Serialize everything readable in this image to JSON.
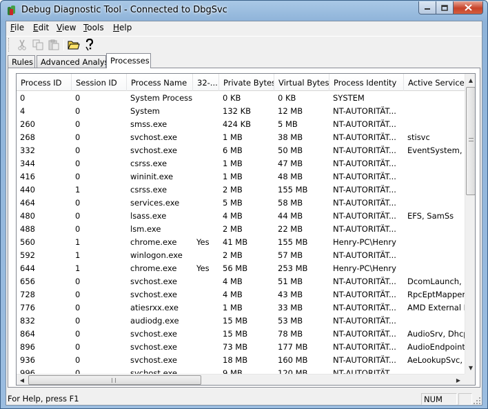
{
  "window": {
    "title": "Debug Diagnostic Tool - Connected to DbgSvc"
  },
  "menu": [
    {
      "label": "File",
      "u": "F",
      "rest": "ile"
    },
    {
      "label": "Edit",
      "u": "E",
      "rest": "dit"
    },
    {
      "label": "View",
      "u": "V",
      "rest": "iew"
    },
    {
      "label": "Tools",
      "u": "T",
      "rest": "ools"
    },
    {
      "label": "Help",
      "u": "H",
      "rest": "elp"
    }
  ],
  "toolbar": {
    "icons": [
      "cut-icon",
      "copy-icon",
      "paste-icon",
      "open-folder-icon",
      "help-icon"
    ]
  },
  "tabs": [
    "Rules",
    "Advanced Analysis",
    "Processes"
  ],
  "active_tab": "Processes",
  "table": {
    "columns": [
      "Process ID",
      "Session ID",
      "Process Name",
      "32-...",
      "Private Bytes",
      "Virtual Bytes",
      "Process Identity",
      "Active Services"
    ],
    "rows": [
      [
        "0",
        "0",
        "System Process",
        "",
        "0 KB",
        "0 KB",
        "SYSTEM",
        ""
      ],
      [
        "4",
        "0",
        "System",
        "",
        "132 KB",
        "12 MB",
        "NT-AUTORITÄT...",
        ""
      ],
      [
        "260",
        "0",
        "smss.exe",
        "",
        "424 KB",
        "5 MB",
        "NT-AUTORITÄT...",
        ""
      ],
      [
        "268",
        "0",
        "svchost.exe",
        "",
        "1 MB",
        "38 MB",
        "NT-AUTORITÄT...",
        "stisvc"
      ],
      [
        "332",
        "0",
        "svchost.exe",
        "",
        "6 MB",
        "50 MB",
        "NT-AUTORITÄT...",
        "EventSystem, ne"
      ],
      [
        "344",
        "0",
        "csrss.exe",
        "",
        "1 MB",
        "47 MB",
        "NT-AUTORITÄT...",
        ""
      ],
      [
        "416",
        "0",
        "wininit.exe",
        "",
        "1 MB",
        "48 MB",
        "NT-AUTORITÄT...",
        ""
      ],
      [
        "440",
        "1",
        "csrss.exe",
        "",
        "2 MB",
        "155 MB",
        "NT-AUTORITÄT...",
        ""
      ],
      [
        "464",
        "0",
        "services.exe",
        "",
        "5 MB",
        "58 MB",
        "NT-AUTORITÄT...",
        ""
      ],
      [
        "480",
        "0",
        "lsass.exe",
        "",
        "4 MB",
        "44 MB",
        "NT-AUTORITÄT...",
        "EFS, SamSs"
      ],
      [
        "488",
        "0",
        "lsm.exe",
        "",
        "2 MB",
        "22 MB",
        "NT-AUTORITÄT...",
        ""
      ],
      [
        "560",
        "1",
        "chrome.exe",
        "Yes",
        "41 MB",
        "155 MB",
        "Henry-PC\\Henry",
        ""
      ],
      [
        "592",
        "1",
        "winlogon.exe",
        "",
        "2 MB",
        "57 MB",
        "NT-AUTORITÄT...",
        ""
      ],
      [
        "644",
        "1",
        "chrome.exe",
        "Yes",
        "56 MB",
        "253 MB",
        "Henry-PC\\Henry",
        ""
      ],
      [
        "656",
        "0",
        "svchost.exe",
        "",
        "4 MB",
        "51 MB",
        "NT-AUTORITÄT...",
        "DcomLaunch, P"
      ],
      [
        "728",
        "0",
        "svchost.exe",
        "",
        "4 MB",
        "43 MB",
        "NT-AUTORITÄT...",
        "RpcEptMapper,"
      ],
      [
        "776",
        "0",
        "atiesrxx.exe",
        "",
        "1 MB",
        "33 MB",
        "NT-AUTORITÄT...",
        "AMD External Ev"
      ],
      [
        "832",
        "0",
        "audiodg.exe",
        "",
        "15 MB",
        "53 MB",
        "NT-AUTORITÄT...",
        ""
      ],
      [
        "864",
        "0",
        "svchost.exe",
        "",
        "15 MB",
        "78 MB",
        "NT-AUTORITÄT...",
        "AudioSrv, Dhcp,"
      ],
      [
        "896",
        "0",
        "svchost.exe",
        "",
        "73 MB",
        "177 MB",
        "NT-AUTORITÄT...",
        "AudioEndpointB"
      ],
      [
        "936",
        "0",
        "svchost.exe",
        "",
        "18 MB",
        "160 MB",
        "NT-AUTORITÄT...",
        "AeLookupSvc, B"
      ],
      [
        "996",
        "0",
        "svchost.exe",
        "",
        "9 MB",
        "120 MB",
        "NT-AUTORITÄT...",
        ""
      ]
    ]
  },
  "status": {
    "help": "For Help, press F1",
    "num": "NUM"
  }
}
